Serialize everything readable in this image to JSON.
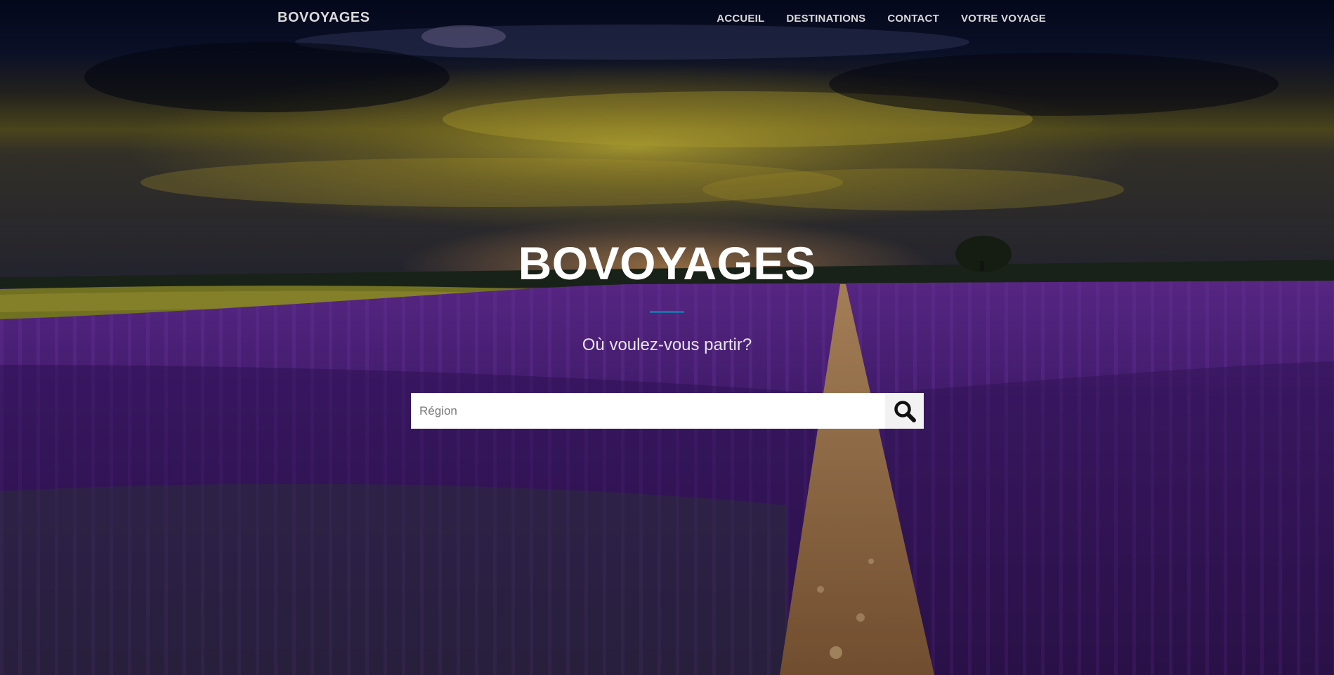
{
  "navbar": {
    "brand": "BOVOYAGES",
    "links": [
      {
        "label": "ACCUEIL"
      },
      {
        "label": "DESTINATIONS"
      },
      {
        "label": "CONTACT"
      },
      {
        "label": "VOTRE VOYAGE"
      }
    ]
  },
  "hero": {
    "title": "BOVOYAGES",
    "subtitle": "Où voulez-vous partir?",
    "background": "lavender-field-sunset"
  },
  "search": {
    "placeholder": "Région",
    "value": "",
    "button_icon": "search-icon"
  },
  "colors": {
    "accent": "#1e6fa8",
    "nav_text": "#d9d9d9",
    "title_text": "#ffffff"
  }
}
